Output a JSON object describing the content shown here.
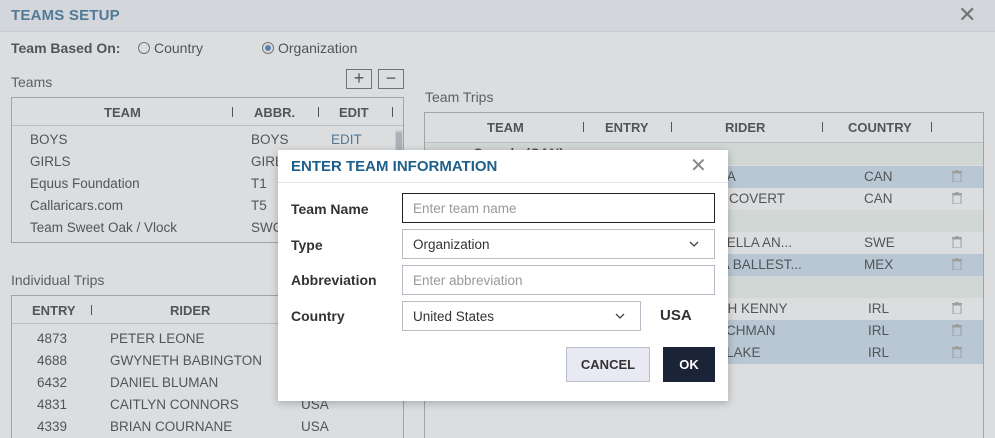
{
  "window": {
    "title": "TEAMS SETUP",
    "close_symbol": "✕"
  },
  "team_basis": {
    "label": "Team Based On:",
    "options": [
      {
        "label": "Country",
        "selected": false
      },
      {
        "label": "Organization",
        "selected": true
      }
    ]
  },
  "teams": {
    "label": "Teams",
    "add_symbol": "+",
    "remove_symbol": "−",
    "columns": [
      "TEAM",
      "ABBR.",
      "EDIT"
    ],
    "rows": [
      {
        "team": "BOYS",
        "abbr": "BOYS",
        "edit": "EDIT"
      },
      {
        "team": "GIRLS",
        "abbr": "GIRL",
        "edit": ""
      },
      {
        "team": "Equus Foundation",
        "abbr": "T1",
        "edit": ""
      },
      {
        "team": "Callaricars.com",
        "abbr": "T5",
        "edit": ""
      },
      {
        "team": "Team Sweet Oak / Vlock",
        "abbr": "SWC",
        "edit": ""
      }
    ]
  },
  "individual_trips": {
    "label": "Individual Trips",
    "columns": [
      "ENTRY",
      "RIDER"
    ],
    "rows": [
      {
        "entry": "4873",
        "rider": "PETER LEONE",
        "country": ""
      },
      {
        "entry": "4688",
        "rider": "GWYNETH BABINGTON",
        "country": ""
      },
      {
        "entry": "6432",
        "rider": "DANIEL BLUMAN",
        "country": ""
      },
      {
        "entry": "4831",
        "rider": "CAITLYN CONNORS",
        "country": "USA"
      },
      {
        "entry": "4339",
        "rider": "BRIAN COURNANE",
        "country": "USA"
      }
    ]
  },
  "team_trips": {
    "label": "Team Trips",
    "columns": [
      "TEAM",
      "ENTRY",
      "RIDER",
      "COUNTRY"
    ],
    "partial_group_label": "Canada (CAN)",
    "rows": [
      {
        "rider": "NA",
        "country": "CAN",
        "selected": true,
        "group": false
      },
      {
        "rider": "A COVERT",
        "country": "CAN",
        "selected": false,
        "group": false
      },
      {
        "rider": "",
        "country": "",
        "selected": false,
        "group": true
      },
      {
        "rider": "NELLA AN...",
        "country": "SWE",
        "selected": false,
        "group": false
      },
      {
        "rider": "IA BALLEST...",
        "country": "MEX",
        "selected": true,
        "group": false
      },
      {
        "rider": "",
        "country": "",
        "selected": false,
        "group": true
      },
      {
        "rider": "GH KENNY",
        "country": "IRL",
        "selected": false,
        "group": false
      },
      {
        "rider": "ACHMAN",
        "country": "IRL",
        "selected": true,
        "group": false
      },
      {
        "rider": "BLAKE",
        "country": "IRL",
        "selected": true,
        "group": false
      }
    ]
  },
  "modal": {
    "title": "ENTER TEAM INFORMATION",
    "close_symbol": "✕",
    "fields": {
      "team_name": {
        "label": "Team Name",
        "placeholder": "Enter team name",
        "value": ""
      },
      "type": {
        "label": "Type",
        "value": "Organization"
      },
      "abbreviation": {
        "label": "Abbreviation",
        "placeholder": "Enter abbreviation",
        "value": ""
      },
      "country": {
        "label": "Country",
        "value": "United States",
        "code": "USA"
      }
    },
    "cancel_label": "CANCEL",
    "ok_label": "OK"
  },
  "colors": {
    "accent": "#1f5f8b",
    "selected_row": "#c9dcee",
    "ok_button": "#1b2437"
  }
}
